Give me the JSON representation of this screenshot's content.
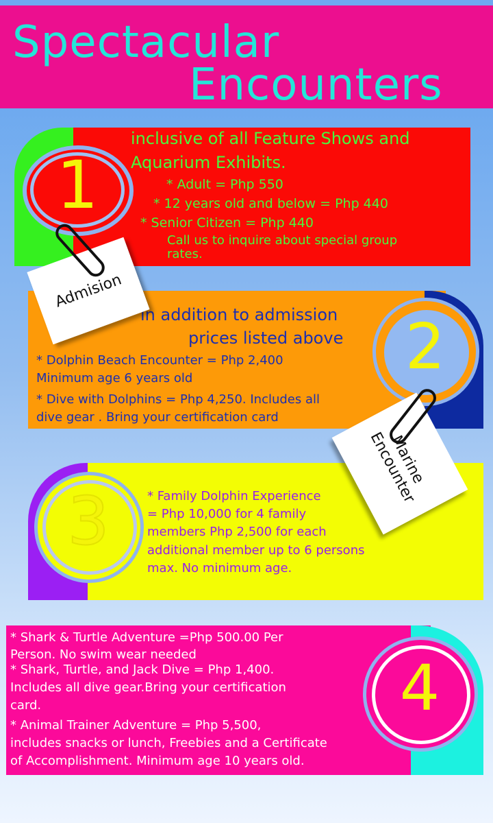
{
  "title": {
    "line1": "Spectacular",
    "line2": "Encounters"
  },
  "colors": {
    "header": "#ec0f8f",
    "title": "#24e6d8",
    "section1": "#fb0a06",
    "section2": "#fd9a08",
    "section3": "#f3fd04",
    "section4": "#fb0a9a"
  },
  "sections": [
    {
      "number": "1",
      "lines": [
        "inclusive of all Feature Shows and",
        "Aquarium Exhibits.",
        "* Adult  =  Php 550",
        "* 12 years old and below  =   Php 440",
        "* Senior Citizen  =  Php 440",
        "Call us to inquire about special group",
        "rates."
      ]
    },
    {
      "number": "2",
      "lines": [
        "in addition to admission",
        "prices listed above",
        "* Dolphin Beach Encounter = Php 2,400",
        "Minimum age 6 years old",
        "* Dive with Dolphins = Php 4,250. Includes all",
        "dive gear . Bring your certification card"
      ]
    },
    {
      "number": "3",
      "lines": [
        "* Family Dolphin Experience",
        " = Php 10,000 for 4 family",
        "members Php 2,500 for each",
        "additional member up to 6 persons",
        "max. No minimum age."
      ]
    },
    {
      "number": "4",
      "lines": [
        "* Shark & Turtle Adventure =Php 500.00 Per",
        "Person. No swim wear needed",
        "* Shark, Turtle, and Jack Dive = Php 1,400.",
        "Includes all dive gear.Bring your certification",
        "card.",
        "* Animal Trainer Adventure = Php 5,500,",
        "includes snacks or lunch, Freebies and a Certificate",
        "of Accomplishment. Minimum age 10 years old."
      ]
    }
  ],
  "notes": {
    "admission": "Admision",
    "marine_line1": "Marine",
    "marine_line2": "Encounter"
  }
}
